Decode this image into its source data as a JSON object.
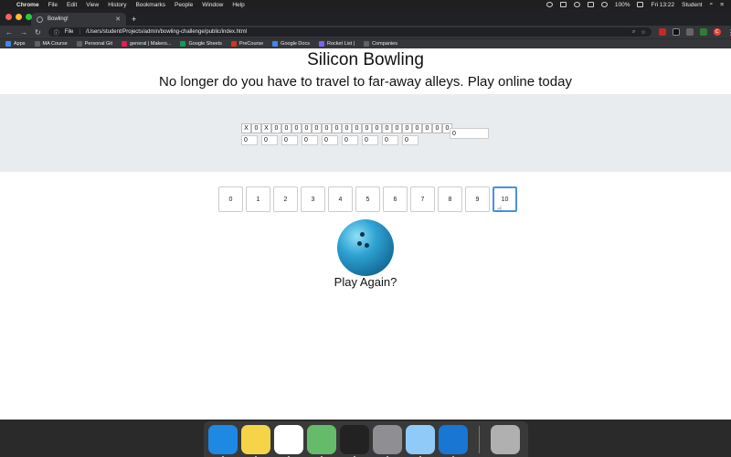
{
  "menubar": {
    "app": "Chrome",
    "items": [
      "File",
      "Edit",
      "View",
      "History",
      "Bookmarks",
      "People",
      "Window",
      "Help"
    ],
    "battery": "100%",
    "clock": "Fri 13:22",
    "user": "Student"
  },
  "browser": {
    "tab_title": "Bowling!",
    "new_tab": "+",
    "url_scheme": "File",
    "url": "/Users/student/Projects/admin/bowling-challenge/public/index.html",
    "bookmarks": [
      {
        "label": "Apps",
        "color": "#4285f4"
      },
      {
        "label": "MA Course",
        "color": "#5f6368"
      },
      {
        "label": "Personal Git",
        "color": "#5f6368"
      },
      {
        "label": "general | Makers...",
        "color": "#e01e5a"
      },
      {
        "label": "Google Sheets",
        "color": "#0f9d58"
      },
      {
        "label": "PreCourse",
        "color": "#d93025"
      },
      {
        "label": "Google Docs",
        "color": "#4285f4"
      },
      {
        "label": "Rocket List |",
        "color": "#7b61ff"
      },
      {
        "label": "Companies",
        "color": "#5f6368"
      }
    ],
    "avatar": "C"
  },
  "page": {
    "title": "Silicon Bowling",
    "subtitle": "No longer do you have to travel to far-away alleys. Play online today",
    "rolls": [
      "X",
      "0",
      "X",
      "0",
      "0",
      "0",
      "0",
      "0",
      "0",
      "0",
      "0",
      "0",
      "0",
      "0",
      "0",
      "0",
      "0",
      "0",
      "0",
      "0",
      "0"
    ],
    "frame_totals": [
      "0",
      "0",
      "0",
      "0",
      "0",
      "0",
      "0",
      "0",
      "0"
    ],
    "total": "0",
    "pins": [
      "0",
      "1",
      "2",
      "3",
      "4",
      "5",
      "6",
      "7",
      "8",
      "9",
      "10"
    ],
    "active_pin": "10",
    "play_again": "Play Again?"
  },
  "dock": {
    "apps": [
      {
        "name": "Finder",
        "color": "#1e88e5"
      },
      {
        "name": "Notes",
        "color": "#f5d547"
      },
      {
        "name": "Chrome",
        "color": "#ffffff"
      },
      {
        "name": "Atom",
        "color": "#66bb6a"
      },
      {
        "name": "Terminal",
        "color": "#222222"
      },
      {
        "name": "System Preferences",
        "color": "#8e8e93"
      },
      {
        "name": "Preview",
        "color": "#90caf9"
      },
      {
        "name": "QuickTime",
        "color": "#1976d2"
      },
      {
        "name": "Trash",
        "color": "#b0b0b0"
      }
    ]
  }
}
